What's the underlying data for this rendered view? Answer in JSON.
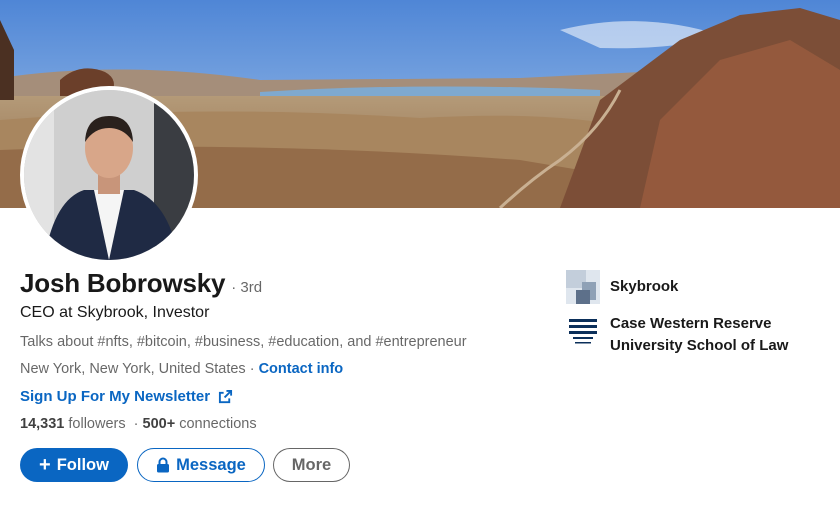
{
  "profile": {
    "name": "Josh Bobrowsky",
    "degree": "· 3rd",
    "headline": "CEO at Skybrook, Investor",
    "talks_about": "Talks about #nfts, #bitcoin, #business, #education, and #entrepreneur",
    "location": "New York, New York, United States",
    "location_separator": " · ",
    "contact_info": "Contact info",
    "newsletter": "Sign Up For My Newsletter",
    "followers_count": "14,331",
    "followers_label": " followers",
    "connections_prefix": "  · ",
    "connections_count": "500+",
    "connections_label": " connections"
  },
  "actions": {
    "follow_icon": "+",
    "follow": "Follow",
    "message": "Message",
    "more": "More"
  },
  "organizations": [
    {
      "name": "Skybrook",
      "logo": "skybrook-logo"
    },
    {
      "name": "Case Western Reserve University School of Law",
      "logo": "case-western-reserve-logo"
    }
  ],
  "icons": {
    "external_link": "external-link-icon",
    "lock": "lock-icon"
  },
  "colors": {
    "accent": "#0a66c2",
    "text_primary": "rgba(0,0,0,0.9)",
    "text_secondary": "rgba(0,0,0,0.6)"
  }
}
